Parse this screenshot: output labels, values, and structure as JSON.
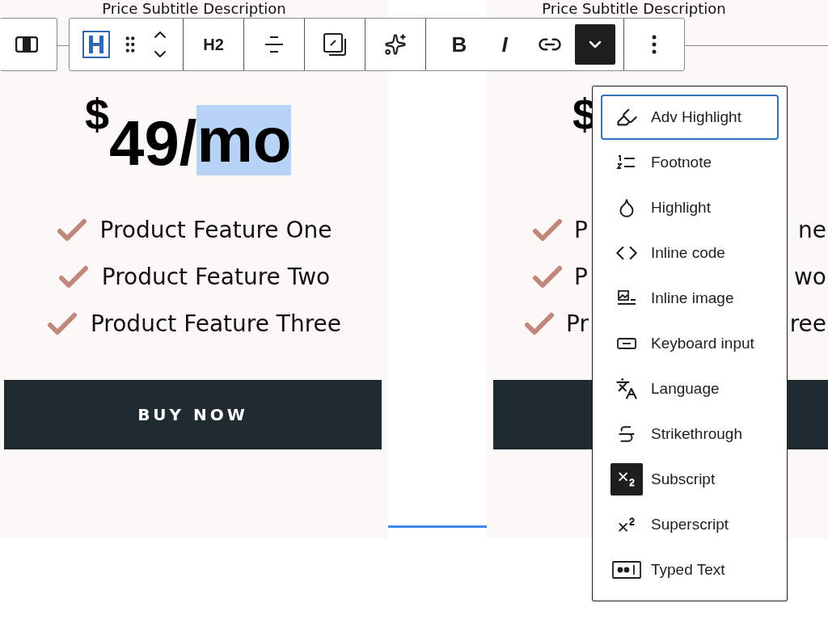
{
  "cards": [
    {
      "subtitle": "Price Subtitle Description",
      "price": {
        "currency": "$",
        "amount": "49/",
        "unit": "mo",
        "unit_selected": true
      },
      "features": [
        "Product Feature One",
        "Product Feature Two",
        "Product Feature Three"
      ],
      "button": "BUY NOW"
    }
  ],
  "partial_card": {
    "subtitle": "Price Subtitle Description",
    "currency": "$",
    "features": [
      {
        "start": "P",
        "end": "ne"
      },
      {
        "start": "P",
        "end": "wo"
      },
      {
        "start": "Pr",
        "end": "ree"
      }
    ]
  },
  "toolbar": {
    "heading_level": "H2",
    "bold": "B",
    "italic": "I",
    "more_formats_pressed": true
  },
  "menu": {
    "items": [
      {
        "label": "Adv Highlight",
        "focused": true,
        "active": false
      },
      {
        "label": "Footnote",
        "focused": false,
        "active": false
      },
      {
        "label": "Highlight",
        "focused": false,
        "active": false
      },
      {
        "label": "Inline code",
        "focused": false,
        "active": false
      },
      {
        "label": "Inline image",
        "focused": false,
        "active": false
      },
      {
        "label": "Keyboard input",
        "focused": false,
        "active": false
      },
      {
        "label": "Language",
        "focused": false,
        "active": false
      },
      {
        "label": "Strikethrough",
        "focused": false,
        "active": false
      },
      {
        "label": "Subscript",
        "focused": false,
        "active": true
      },
      {
        "label": "Superscript",
        "focused": false,
        "active": false
      },
      {
        "label": "Typed Text",
        "focused": false,
        "active": false
      }
    ]
  }
}
